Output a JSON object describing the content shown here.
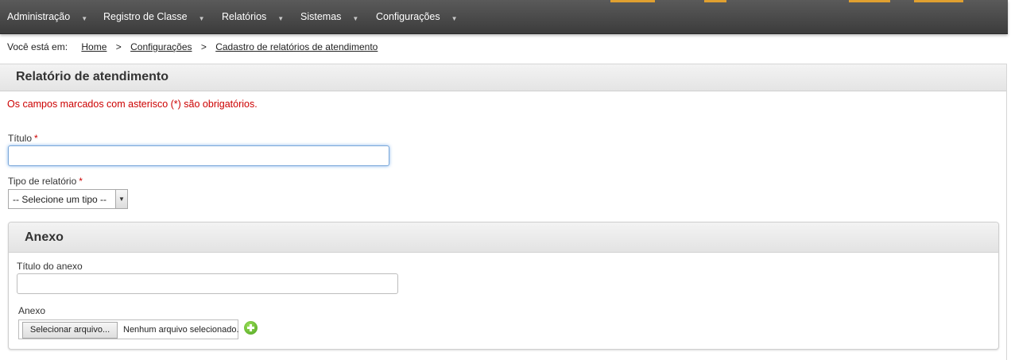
{
  "menu": {
    "items": [
      {
        "label": "Administração"
      },
      {
        "label": "Registro de Classe"
      },
      {
        "label": "Relatórios"
      },
      {
        "label": "Sistemas"
      },
      {
        "label": "Configurações"
      }
    ],
    "caret": "▼"
  },
  "breadcrumb": {
    "lead": "Você está em:",
    "separator": ">",
    "items": [
      "Home",
      "Configurações",
      "Cadastro de relatórios de atendimento"
    ]
  },
  "page": {
    "title": "Relatório de atendimento",
    "required_note": "Os campos marcados com asterisco (*) são obrigatórios."
  },
  "form": {
    "titulo_label": "Título",
    "required_mark": "*",
    "titulo_value": "",
    "tipo_label": "Tipo de relatório",
    "tipo_selected": "-- Selecione um tipo --",
    "select_arrow": "▼"
  },
  "anexo": {
    "title": "Anexo",
    "titulo_anexo_label": "Título do anexo",
    "titulo_anexo_value": "",
    "anexo_label": "Anexo",
    "file_button": "Selecionar arquivo...",
    "file_status": "Nenhum arquivo selecionado."
  },
  "colors": {
    "menubar": "#4a4a4a",
    "accent": "#e0a030",
    "required": "#cc0000",
    "add_icon": "#5cb82a"
  }
}
